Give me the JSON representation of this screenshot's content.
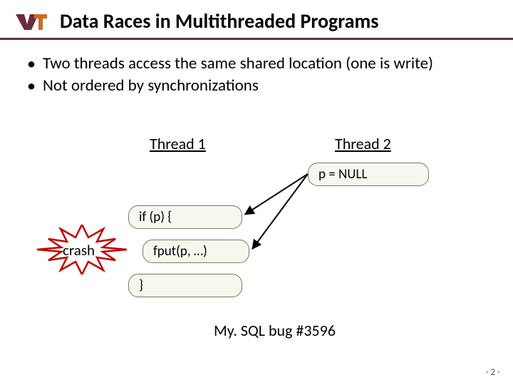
{
  "header": {
    "logo_alt": "vt-logo",
    "title": "Data Races in Multithreaded Programs"
  },
  "bullets": [
    "Two threads access the same shared location (one is write)",
    "Not ordered by synchronizations"
  ],
  "diagram": {
    "thread1_label": "Thread 1",
    "thread2_label": "Thread 2",
    "box_pnull": "p = NULL",
    "box_if": "if (p) {",
    "box_fput": "fput(p, …)",
    "box_close": "}",
    "crash_label": "crash",
    "caption": "My. SQL bug #3596"
  },
  "page_number": "- 2 -"
}
